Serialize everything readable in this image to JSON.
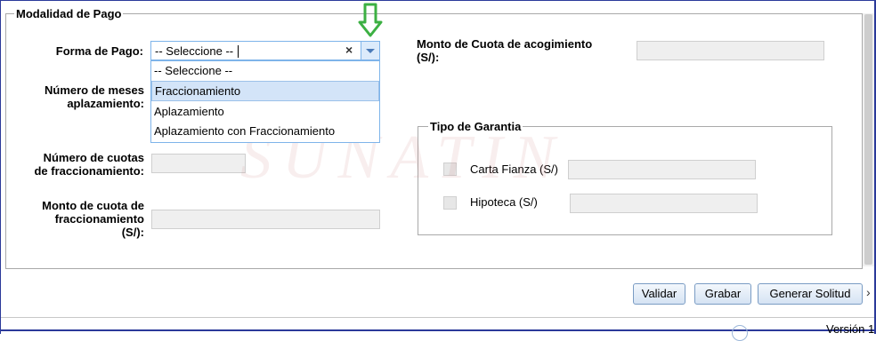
{
  "section": {
    "title": "Modalidad de Pago"
  },
  "payment_form": {
    "label": "Forma de Pago:",
    "selected_value": "-- Seleccione --",
    "clear_symbol": "×",
    "options": [
      "-- Seleccione --",
      "Fraccionamiento",
      "Aplazamiento",
      "Aplazamiento con Fraccionamiento"
    ],
    "highlighted_option": "Fraccionamiento"
  },
  "fields": {
    "months_deferral_label_line1": "Número de meses",
    "months_deferral_label_line2": "aplazamiento:",
    "installments_label_line1": "Número de cuotas",
    "installments_label_line2": "de fraccionamiento:",
    "installment_amount_label_line1": "Monto de cuota de",
    "installment_amount_label_line2": "fraccionamiento",
    "installment_amount_label_line3": "(S/):",
    "acogimiento_label_line1": "Monto de Cuota de acogimiento",
    "acogimiento_label_line2": "(S/):"
  },
  "guarantee": {
    "title": "Tipo de Garantia",
    "bond_label": "Carta Fianza (S/)",
    "mortgage_label": "Hipoteca (S/)"
  },
  "watermark": "SUNATIN",
  "buttons": {
    "validate": "Validar",
    "save": "Grabar",
    "generate": "Generar Solitud"
  },
  "footer": {
    "version": "Versión 1"
  },
  "colors": {
    "frame": "#2b3a9a",
    "accent_border": "#7eb4ea",
    "highlight": "#d3e4f8",
    "arrow": "#3cb043"
  }
}
